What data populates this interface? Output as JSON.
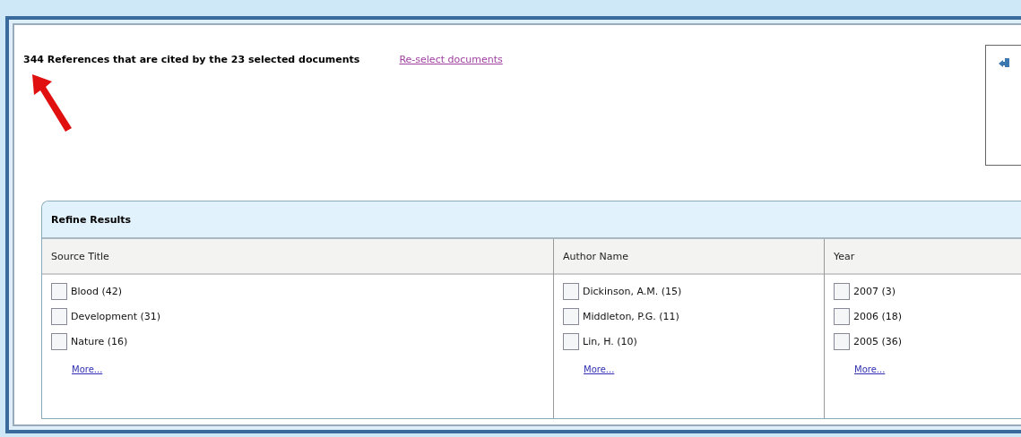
{
  "header": {
    "summary": "344 References that are cited by the 23 selected documents",
    "link": "Re-select documents"
  },
  "refine": {
    "title": "Refine Results",
    "columns": [
      {
        "heading": "Source Title",
        "options": [
          {
            "label": "Blood (42)",
            "checked": false
          },
          {
            "label": "Development (31)",
            "checked": false
          },
          {
            "label": "Nature (16)",
            "checked": false
          }
        ],
        "more": "More..."
      },
      {
        "heading": "Author Name",
        "options": [
          {
            "label": "Dickinson, A.M. (15)",
            "checked": false
          },
          {
            "label": "Middleton, P.G. (11)",
            "checked": false
          },
          {
            "label": "Lin, H. (10)",
            "checked": false
          }
        ],
        "more": "More..."
      },
      {
        "heading": "Year",
        "options": [
          {
            "label": "2007 (3)",
            "checked": false
          },
          {
            "label": "2006 (18)",
            "checked": false
          },
          {
            "label": "2005 (36)",
            "checked": false
          }
        ],
        "more": "More..."
      }
    ]
  }
}
